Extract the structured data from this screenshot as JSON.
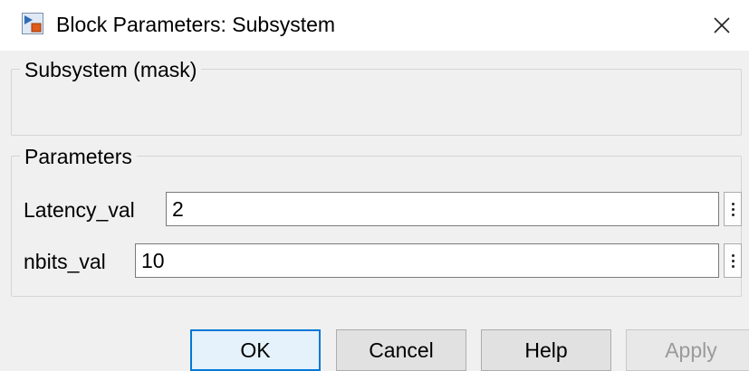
{
  "window": {
    "title": "Block Parameters: Subsystem",
    "app_icon": "simulink-block-icon",
    "close_icon": "close-icon"
  },
  "mask_group": {
    "title": "Subsystem (mask)"
  },
  "parameters_group": {
    "title": "Parameters",
    "fields": [
      {
        "label": "Latency_val",
        "value": "2"
      },
      {
        "label": "nbits_val",
        "value": "10"
      }
    ],
    "options_icon": "vertical-ellipsis-icon"
  },
  "buttons": {
    "ok": "OK",
    "cancel": "Cancel",
    "help": "Help",
    "apply": "Apply"
  },
  "colors": {
    "client_background": "#f0f0f0",
    "default_button_border": "#0078d7",
    "disabled_text": "#9a9a9a"
  }
}
